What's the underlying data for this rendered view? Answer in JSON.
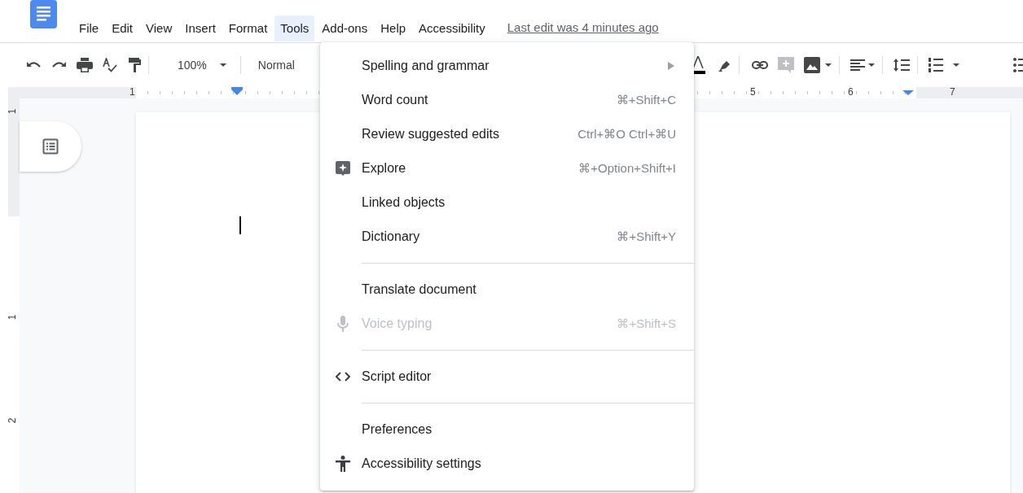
{
  "menu_bar": {
    "items": [
      {
        "label": "File",
        "selected": false
      },
      {
        "label": "Edit",
        "selected": false
      },
      {
        "label": "View",
        "selected": false
      },
      {
        "label": "Insert",
        "selected": false
      },
      {
        "label": "Format",
        "selected": false
      },
      {
        "label": "Tools",
        "selected": true
      },
      {
        "label": "Add-ons",
        "selected": false
      },
      {
        "label": "Help",
        "selected": false
      },
      {
        "label": "Accessibility",
        "selected": false
      }
    ],
    "last_edit": "Last edit was 4 minutes ago"
  },
  "toolbar": {
    "zoom": "100%",
    "style": "Normal"
  },
  "ruler": {
    "horizontal_labels": [
      "1",
      "5",
      "6",
      "7"
    ],
    "vertical_labels": [
      "1",
      "1",
      "2"
    ]
  },
  "tools_menu": {
    "items": [
      {
        "kind": "plain",
        "label": "Spelling and grammar",
        "submenu": true,
        "disabled": false
      },
      {
        "kind": "plain",
        "label": "Word count",
        "shortcut": "⌘+Shift+C",
        "submenu": false,
        "disabled": false
      },
      {
        "kind": "plain",
        "label": "Review suggested edits",
        "shortcut": "Ctrl+⌘O Ctrl+⌘U",
        "submenu": false,
        "disabled": false
      },
      {
        "kind": "explore",
        "label": "Explore",
        "shortcut": "⌘+Option+Shift+I",
        "submenu": false,
        "disabled": false
      },
      {
        "kind": "plain",
        "label": "Linked objects",
        "submenu": false,
        "disabled": false
      },
      {
        "kind": "plain",
        "label": "Dictionary",
        "shortcut": "⌘+Shift+Y",
        "submenu": false,
        "disabled": false
      },
      {
        "kind": "separator"
      },
      {
        "kind": "plain",
        "label": "Translate document",
        "submenu": false,
        "disabled": false
      },
      {
        "kind": "voice",
        "label": "Voice typing",
        "shortcut": "⌘+Shift+S",
        "submenu": false,
        "disabled": true
      },
      {
        "kind": "separator"
      },
      {
        "kind": "script",
        "label": "Script editor",
        "submenu": false,
        "disabled": false
      },
      {
        "kind": "separator"
      },
      {
        "kind": "plain",
        "label": "Preferences",
        "submenu": false,
        "disabled": false
      },
      {
        "kind": "accessibility",
        "label": "Accessibility settings",
        "submenu": false,
        "disabled": false
      }
    ]
  }
}
